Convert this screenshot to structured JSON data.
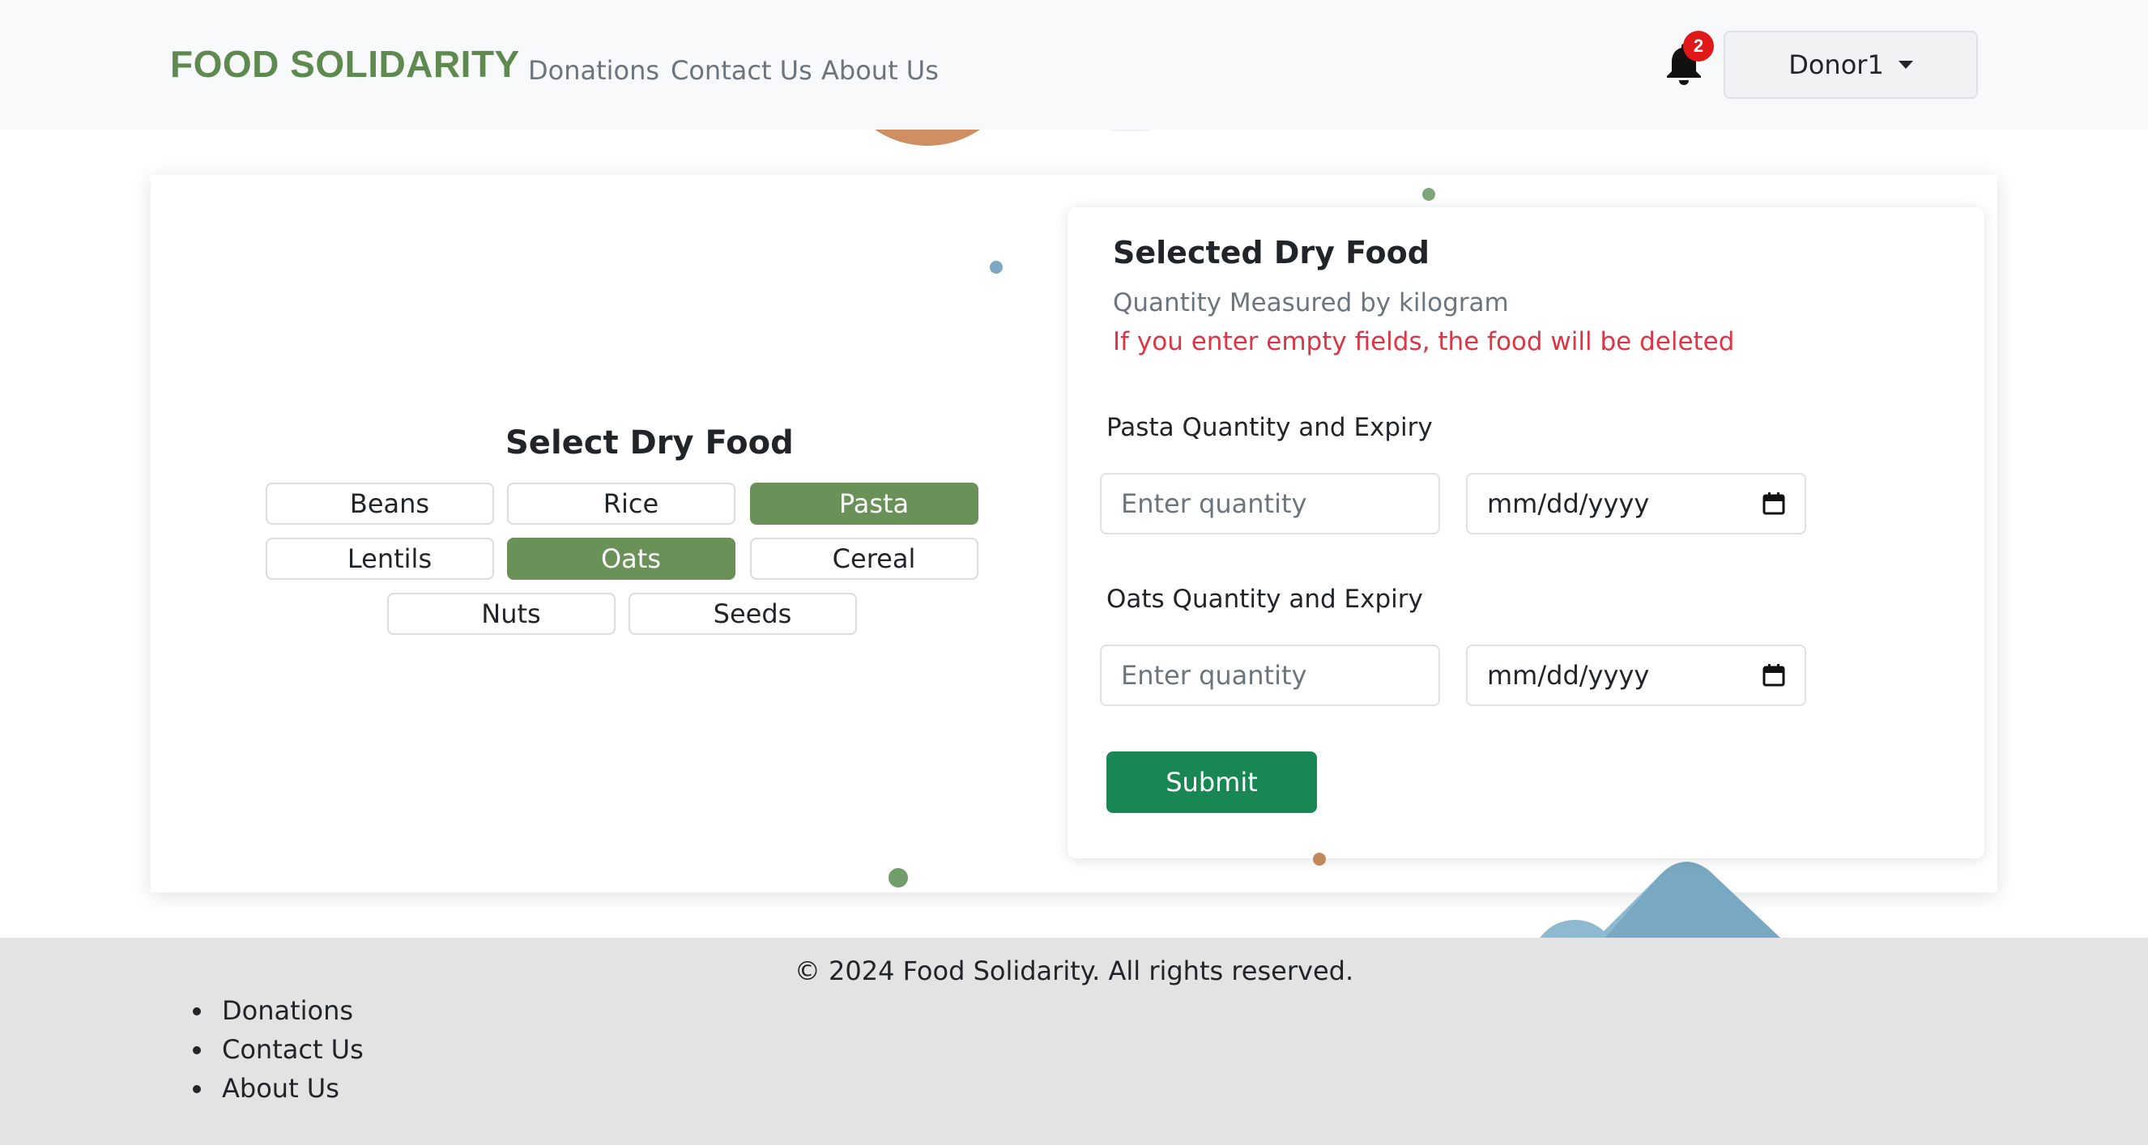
{
  "navbar": {
    "brand": "FOOD SOLIDARITY",
    "links": [
      "Donations",
      "Contact Us",
      "About Us"
    ],
    "notification_count": "2",
    "user": "Donor1"
  },
  "select_panel": {
    "title": "Select Dry Food",
    "items": [
      {
        "label": "Beans",
        "selected": false
      },
      {
        "label": "Rice",
        "selected": false
      },
      {
        "label": "Pasta",
        "selected": true
      },
      {
        "label": "Lentils",
        "selected": false
      },
      {
        "label": "Oats",
        "selected": true
      },
      {
        "label": "Cereal",
        "selected": false
      },
      {
        "label": "Nuts",
        "selected": false
      },
      {
        "label": "Seeds",
        "selected": false
      }
    ]
  },
  "selected_panel": {
    "title": "Selected Dry Food",
    "subtitle": "Quantity Measured by kilogram",
    "warning": "If you enter empty fields, the food will be deleted",
    "fields": [
      {
        "label": "Pasta Quantity and Expiry",
        "quantity_placeholder": "Enter quantity",
        "date_placeholder": "mm/dd/yyyy"
      },
      {
        "label": "Oats Quantity and Expiry",
        "quantity_placeholder": "Enter quantity",
        "date_placeholder": "mm/dd/yyyy"
      }
    ],
    "submit_label": "Submit"
  },
  "footer": {
    "copyright": "© 2024 Food Solidarity. All rights reserved.",
    "links": [
      "Donations",
      "Contact Us",
      "About Us"
    ]
  },
  "colors": {
    "brand": "#5e8a4f",
    "selected_item": "#6a9157",
    "submit": "#198754",
    "warning": "#dc3545",
    "badge": "#e01818"
  }
}
